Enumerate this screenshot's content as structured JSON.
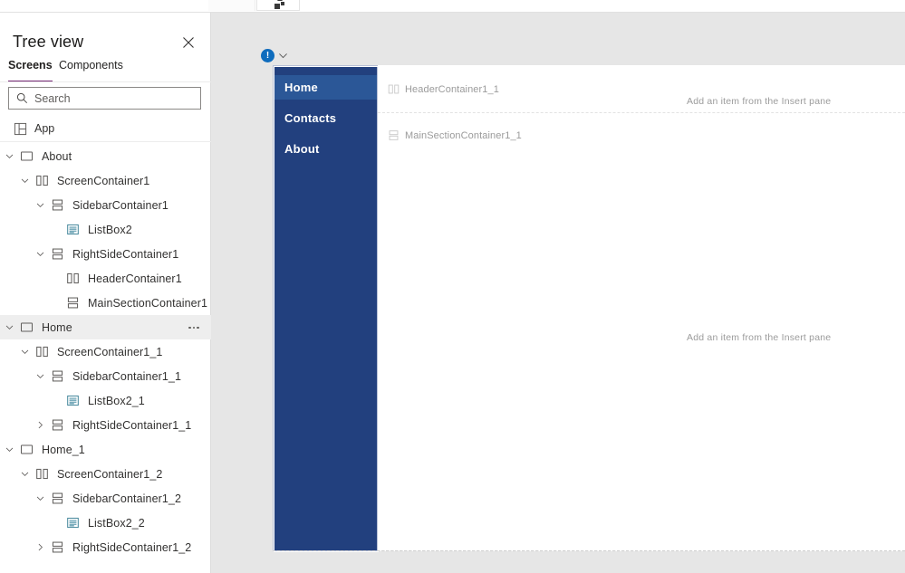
{
  "window": {
    "toolbar_partial_icon": "shapes-icon"
  },
  "tree_view": {
    "title": "Tree view",
    "close_icon": "close-icon",
    "tabs": [
      {
        "id": "screens",
        "label": "Screens",
        "active": true
      },
      {
        "id": "components",
        "label": "Components",
        "active": false
      }
    ],
    "search": {
      "placeholder": "Search",
      "value": "",
      "icon": "search-icon"
    },
    "app_row": {
      "label": "App",
      "icon": "app-grid-icon"
    },
    "nodes": [
      {
        "label": "About",
        "indent": 0,
        "icon": "screen-icon",
        "chevron": "down",
        "selected": false,
        "more": false
      },
      {
        "label": "ScreenContainer1",
        "indent": 1,
        "icon": "columns-icon",
        "chevron": "down",
        "selected": false,
        "more": false
      },
      {
        "label": "SidebarContainer1",
        "indent": 2,
        "icon": "rows-icon",
        "chevron": "down",
        "selected": false,
        "more": false
      },
      {
        "label": "ListBox2",
        "indent": 3,
        "icon": "listbox-icon",
        "chevron": "none",
        "selected": false,
        "more": false
      },
      {
        "label": "RightSideContainer1",
        "indent": 2,
        "icon": "rows-icon",
        "chevron": "down",
        "selected": false,
        "more": false
      },
      {
        "label": "HeaderContainer1",
        "indent": 3,
        "icon": "columns-icon",
        "chevron": "none",
        "selected": false,
        "more": false
      },
      {
        "label": "MainSectionContainer1",
        "indent": 3,
        "icon": "rows-icon",
        "chevron": "none",
        "selected": false,
        "more": false
      },
      {
        "label": "Home",
        "indent": 0,
        "icon": "screen-icon",
        "chevron": "down",
        "selected": true,
        "more": true
      },
      {
        "label": "ScreenContainer1_1",
        "indent": 1,
        "icon": "columns-icon",
        "chevron": "down",
        "selected": false,
        "more": false
      },
      {
        "label": "SidebarContainer1_1",
        "indent": 2,
        "icon": "rows-icon",
        "chevron": "down",
        "selected": false,
        "more": false
      },
      {
        "label": "ListBox2_1",
        "indent": 3,
        "icon": "listbox-icon",
        "chevron": "none",
        "selected": false,
        "more": false
      },
      {
        "label": "RightSideContainer1_1",
        "indent": 2,
        "icon": "rows-icon",
        "chevron": "right",
        "selected": false,
        "more": false
      },
      {
        "label": "Home_1",
        "indent": 0,
        "icon": "screen-icon",
        "chevron": "down",
        "selected": false,
        "more": false
      },
      {
        "label": "ScreenContainer1_2",
        "indent": 1,
        "icon": "columns-icon",
        "chevron": "down",
        "selected": false,
        "more": false
      },
      {
        "label": "SidebarContainer1_2",
        "indent": 2,
        "icon": "rows-icon",
        "chevron": "down",
        "selected": false,
        "more": false
      },
      {
        "label": "ListBox2_2",
        "indent": 3,
        "icon": "listbox-icon",
        "chevron": "none",
        "selected": false,
        "more": false
      },
      {
        "label": "RightSideContainer1_2",
        "indent": 2,
        "icon": "rows-icon",
        "chevron": "right",
        "selected": false,
        "more": false
      }
    ]
  },
  "canvas": {
    "screen_badge": {
      "icon": "info-badge-icon",
      "glyph": "!",
      "color": "#0f6cbd",
      "chevron_icon": "chevron-down-icon"
    },
    "app_preview": {
      "sidebar": {
        "background_color": "#22407e",
        "active_color": "#2b5797",
        "items": [
          {
            "label": "Home",
            "active": true
          },
          {
            "label": "Contacts",
            "active": false
          },
          {
            "label": "About",
            "active": false
          }
        ]
      },
      "zones": [
        {
          "id": "header",
          "label": "HeaderContainer1_1",
          "icon": "columns-icon",
          "placeholder": "Add an item from the Insert pane"
        },
        {
          "id": "main",
          "label": "MainSectionContainer1_1",
          "icon": "rows-icon",
          "placeholder": "Add an item from the Insert pane"
        }
      ]
    }
  }
}
